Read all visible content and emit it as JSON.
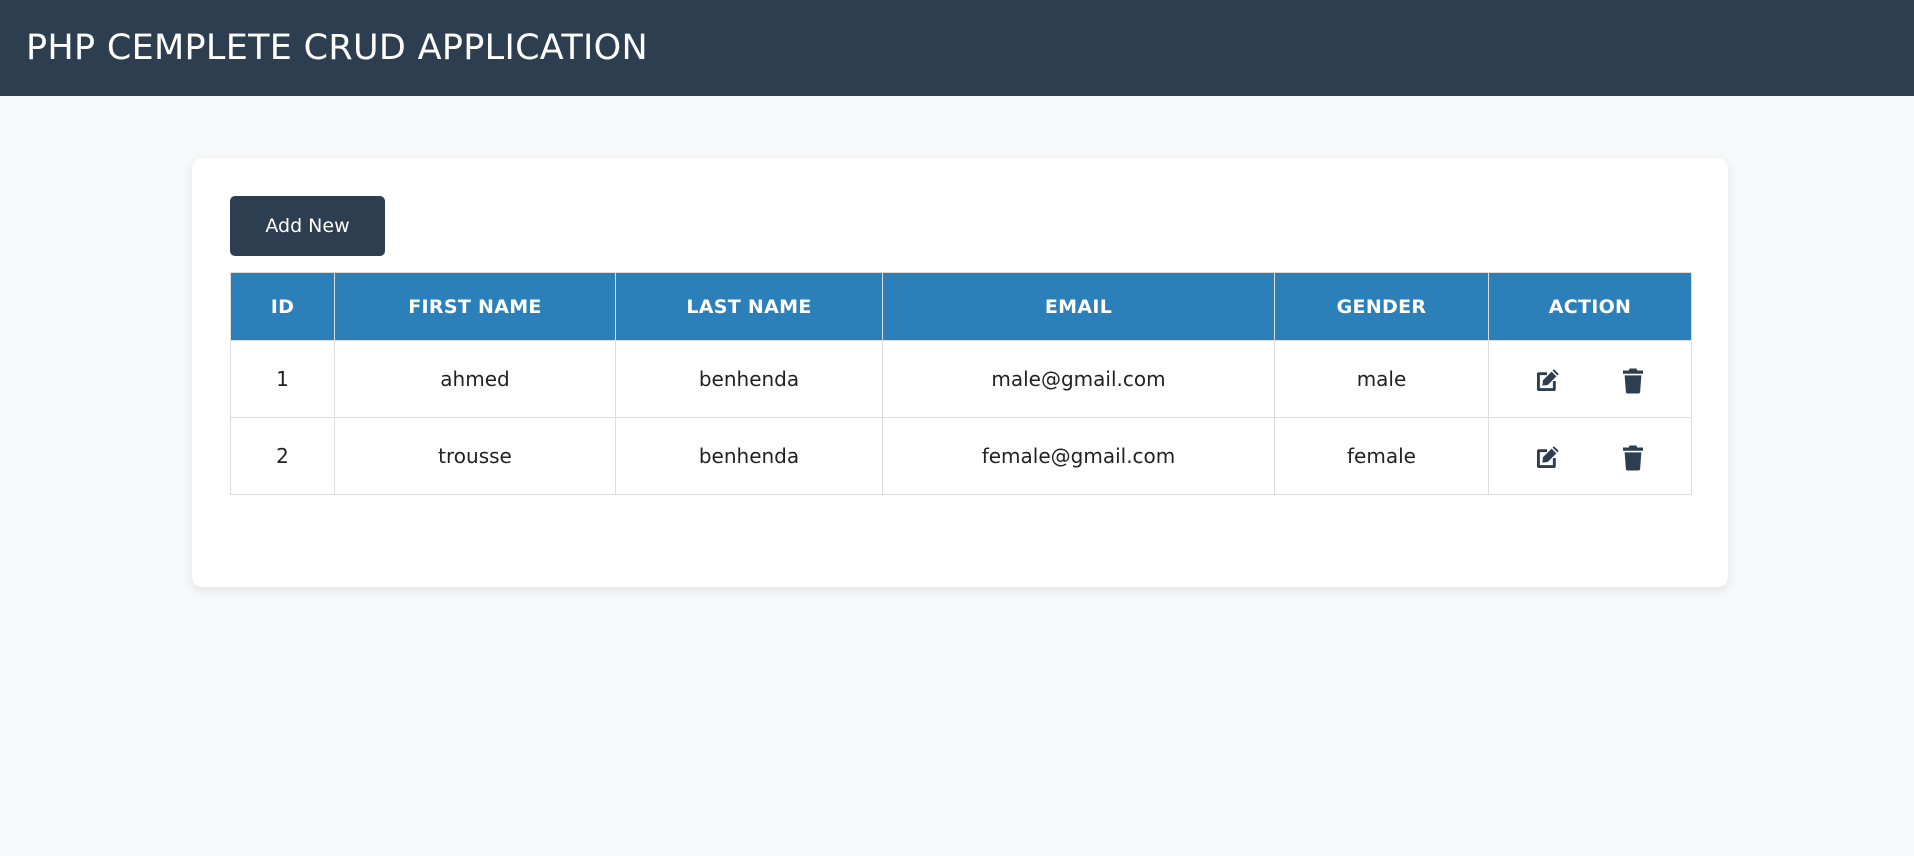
{
  "header": {
    "title": "PHP CEMPLETE CRUD APPLICATION"
  },
  "toolbar": {
    "add_label": "Add New"
  },
  "table": {
    "columns": [
      "ID",
      "FIRST NAME",
      "LAST NAME",
      "EMAIL",
      "GENDER",
      "ACTION"
    ],
    "rows": [
      {
        "id": "1",
        "first_name": "ahmed",
        "last_name": "benhenda",
        "email": "male@gmail.com",
        "gender": "male"
      },
      {
        "id": "2",
        "first_name": "trousse",
        "last_name": "benhenda",
        "email": "female@gmail.com",
        "gender": "female"
      }
    ],
    "row_actions": [
      "edit-icon",
      "trash-icon"
    ]
  },
  "colors": {
    "header_bg": "#2c3e50",
    "table_header_bg": "#2b80b9",
    "page_bg": "#f7f8fa",
    "button_bg": "#2c3e50"
  }
}
